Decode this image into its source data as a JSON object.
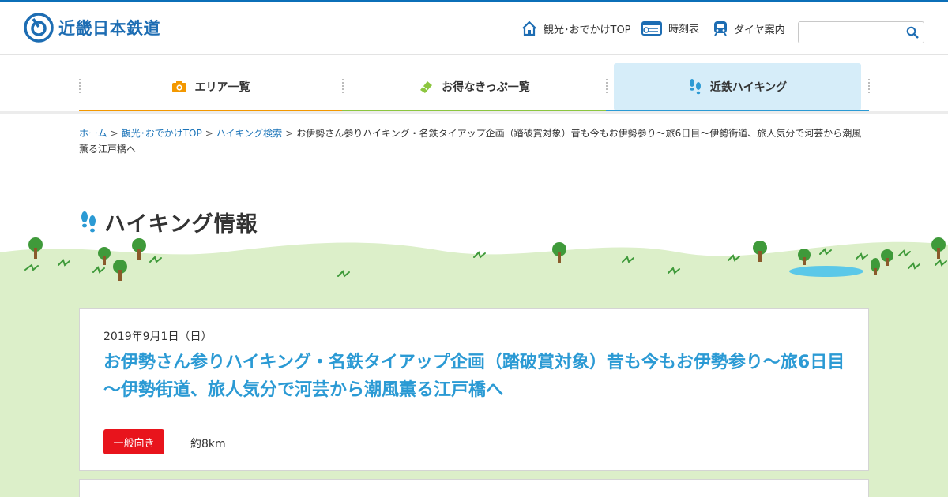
{
  "header": {
    "logo_text": "近畿日本鉄道",
    "links": [
      {
        "label": "観光･おでかけTOP",
        "icon": "home-icon"
      },
      {
        "label": "時刻表",
        "icon": "timetable-icon"
      },
      {
        "label": "ダイヤ案内",
        "icon": "train-icon"
      }
    ],
    "search": {
      "placeholder": "",
      "icon": "search-icon"
    }
  },
  "nav": {
    "items": [
      {
        "label": "エリア一覧",
        "icon": "camera-icon",
        "color": "#f39800"
      },
      {
        "label": "お得なきっぷ一覧",
        "icon": "ticket-icon",
        "color": "#8cc63f"
      },
      {
        "label": "近鉄ハイキング",
        "icon": "footprints-icon",
        "color": "#2b9ad4",
        "active": true
      }
    ]
  },
  "breadcrumb": {
    "items": [
      "ホーム",
      "観光･おでかけTOP",
      "ハイキング検索"
    ],
    "current": "お伊勢さん参りハイキング・名鉄タイアップ企画（踏破賞対象）昔も今もお伊勢参り～旅6日目～伊勢街道、旅人気分で河芸から潮風薫る江戸橋へ",
    "separator": ">"
  },
  "section": {
    "title": "ハイキング情報",
    "icon": "footprints-icon"
  },
  "event": {
    "date": "2019年9月1日（日）",
    "title": "お伊勢さん参りハイキング・名鉄タイアップ企画（踏破賞対象）昔も今もお伊勢参り～旅6日目～伊勢街道、旅人気分で河芸から潮風薫る江戸橋へ",
    "level": "一般向き",
    "distance": "約8km"
  },
  "colors": {
    "accent": "#2b9ad4",
    "brand": "#1d6db3",
    "badge": "#e8141c",
    "grass": "#dcefc9"
  }
}
